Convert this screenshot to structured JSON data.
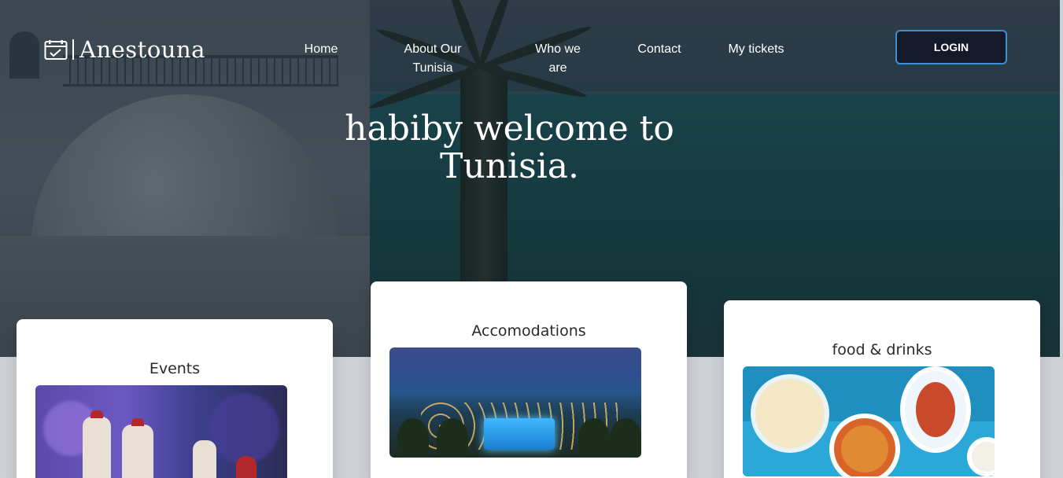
{
  "brand": {
    "name": "Anestouna",
    "logo_icon": "ticket-calendar-icon"
  },
  "nav": {
    "items": [
      {
        "label": "Home"
      },
      {
        "label": "About Our Tunisia"
      },
      {
        "label": "Who we are"
      },
      {
        "label": "Contact"
      },
      {
        "label": "My tickets"
      }
    ],
    "login_label": "LOGIN"
  },
  "hero": {
    "title": "habiby welcome to Tunisia."
  },
  "cards": [
    {
      "title": "Events"
    },
    {
      "title": "Accomodations"
    },
    {
      "title": "food & drinks"
    }
  ],
  "colors": {
    "login_border": "#3e8fd6",
    "login_bg": "#141a2a",
    "page_bg": "#cdd0d4"
  }
}
